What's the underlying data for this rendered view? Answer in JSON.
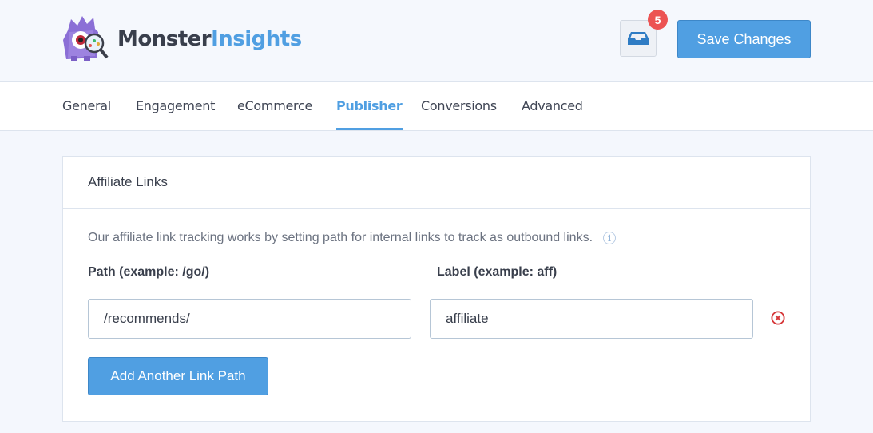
{
  "header": {
    "logo": {
      "part1": "Monster",
      "part2": "Insights",
      "icon": "monster-mascot-icon"
    },
    "inbox": {
      "icon": "inbox-icon",
      "badge_count": "5"
    },
    "save_label": "Save Changes"
  },
  "nav": {
    "tabs": [
      {
        "label": "General",
        "active": false
      },
      {
        "label": "Engagement",
        "active": false
      },
      {
        "label": "eCommerce",
        "active": false
      },
      {
        "label": "Publisher",
        "active": true
      },
      {
        "label": "Conversions",
        "active": false
      },
      {
        "label": "Advanced",
        "active": false
      }
    ]
  },
  "card": {
    "title": "Affiliate Links",
    "description": "Our affiliate link tracking works by setting path for internal links to track as outbound links.",
    "info_icon": "info-icon",
    "path_label": "Path (example: /go/)",
    "label_label": "Label (example: aff)",
    "rows": [
      {
        "path": "/recommends/",
        "label": "affiliate"
      }
    ],
    "remove_icon": "remove-circle-x-icon",
    "add_button": "Add Another Link Path"
  },
  "colors": {
    "accent": "#509fe2",
    "badge": "#ec5353",
    "remove": "#d63638",
    "text": "#393f4c"
  }
}
